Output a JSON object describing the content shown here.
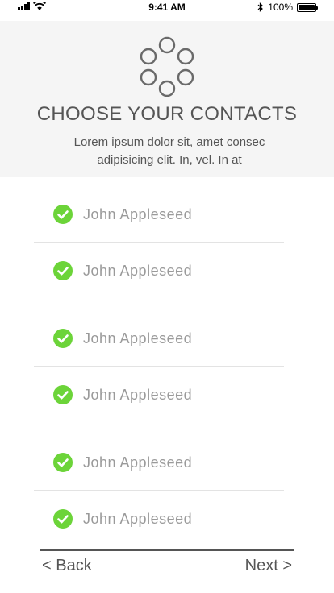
{
  "status_bar": {
    "time": "9:41 AM",
    "battery": "100%",
    "icons": [
      "signal-icon",
      "wifi-icon",
      "bluetooth-icon",
      "battery-icon"
    ]
  },
  "header": {
    "logo_icon": "contacts-ring-icon",
    "title": "CHOOSE YOUR CONTACTS",
    "subtitle": "Lorem ipsum dolor sit, amet consec adipisicing elit. In, vel. In at"
  },
  "contacts": [
    {
      "name": "John Appleseed",
      "selected": true
    },
    {
      "name": "John Appleseed",
      "selected": true
    },
    {
      "name": "John Appleseed",
      "selected": true
    },
    {
      "name": "John Appleseed",
      "selected": true
    },
    {
      "name": "John Appleseed",
      "selected": true
    },
    {
      "name": "John Appleseed",
      "selected": true
    }
  ],
  "nav": {
    "back_label": "< Back",
    "next_label": "Next >"
  },
  "colors": {
    "check_green": "#6cd439",
    "header_bg": "#f5f5f5",
    "text": "#555555",
    "name_text": "#9a9a9a"
  }
}
